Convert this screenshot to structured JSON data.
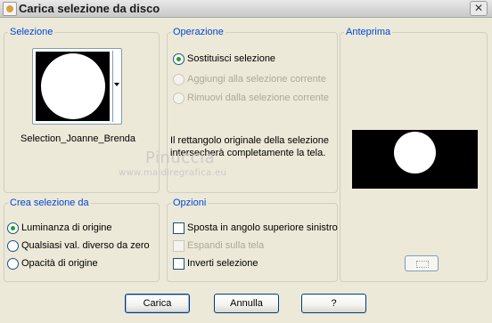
{
  "window": {
    "title": "Carica selezione da disco",
    "close_symbol": "✕"
  },
  "selezione": {
    "legend": "Selezione",
    "file_name": "Selection_Joanne_Brenda"
  },
  "operazione": {
    "legend": "Operazione",
    "options": [
      {
        "label": "Sostituisci selezione",
        "checked": true,
        "disabled": false
      },
      {
        "label": "Aggiungi alla selezione corrente",
        "checked": false,
        "disabled": true
      },
      {
        "label": "Rimuovi dalla selezione corrente",
        "checked": false,
        "disabled": true
      }
    ],
    "note": "Il rettangolo originale della selezione intersecherà completamente la tela."
  },
  "anteprima": {
    "legend": "Anteprima"
  },
  "crea": {
    "legend": "Crea selezione da",
    "options": [
      {
        "label": "Luminanza di origine",
        "checked": true
      },
      {
        "label": "Qualsiasi val. diverso da zero",
        "checked": false
      },
      {
        "label": "Opacità di origine",
        "checked": false
      }
    ]
  },
  "opzioni": {
    "legend": "Opzioni",
    "options": [
      {
        "label": "Sposta in angolo superiore sinistro",
        "checked": false,
        "disabled": false
      },
      {
        "label": "Espandi sulla tela",
        "checked": false,
        "disabled": true
      },
      {
        "label": "Inverti selezione",
        "checked": false,
        "disabled": false
      }
    ]
  },
  "buttons": {
    "load": "Carica",
    "cancel": "Annulla",
    "help": "?"
  },
  "watermark": {
    "line1": "Pinuccia",
    "line2": "www.maidiregrafica.eu"
  }
}
